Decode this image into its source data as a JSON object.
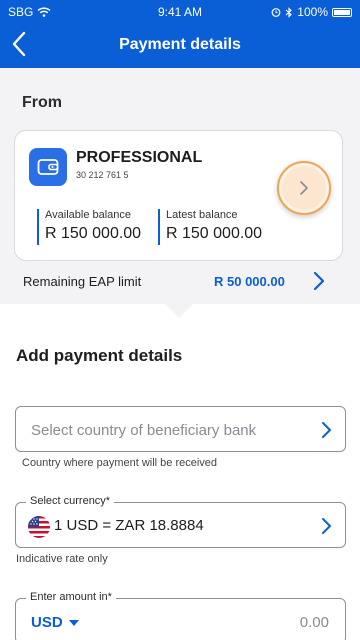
{
  "status_bar": {
    "carrier": "SBG",
    "time": "9:41 AM",
    "battery": "100%"
  },
  "header": {
    "title": "Payment details"
  },
  "from": {
    "label": "From",
    "account_name": "PROFESSIONAL",
    "account_number": "30 212 761 5",
    "available_label": "Available balance",
    "available_value": "R 150 000.00",
    "latest_label": "Latest balance",
    "latest_value": "R 150 000.00"
  },
  "eap": {
    "label": "Remaining EAP limit",
    "value": "R 50 000.00"
  },
  "add_payment": {
    "title": "Add payment details",
    "country_placeholder": "Select country of beneficiary bank",
    "country_helper": "Country where payment will be received",
    "currency_legend": "Select currency*",
    "currency_value": "1 USD = ZAR 18.8884",
    "currency_helper": "Indicative rate only",
    "amount_legend": "Enter amount in*",
    "amount_currency": "USD",
    "amount_value": "0.00"
  },
  "colors": {
    "brand_blue": "#0a5fd7",
    "highlight_orange": "#f0a550"
  },
  "icons": [
    "back-chevron-icon",
    "wifi-icon",
    "alarm-icon",
    "bluetooth-icon",
    "battery-icon",
    "wallet-icon",
    "chevron-right-icon",
    "us-flag-icon",
    "caret-down-icon"
  ]
}
